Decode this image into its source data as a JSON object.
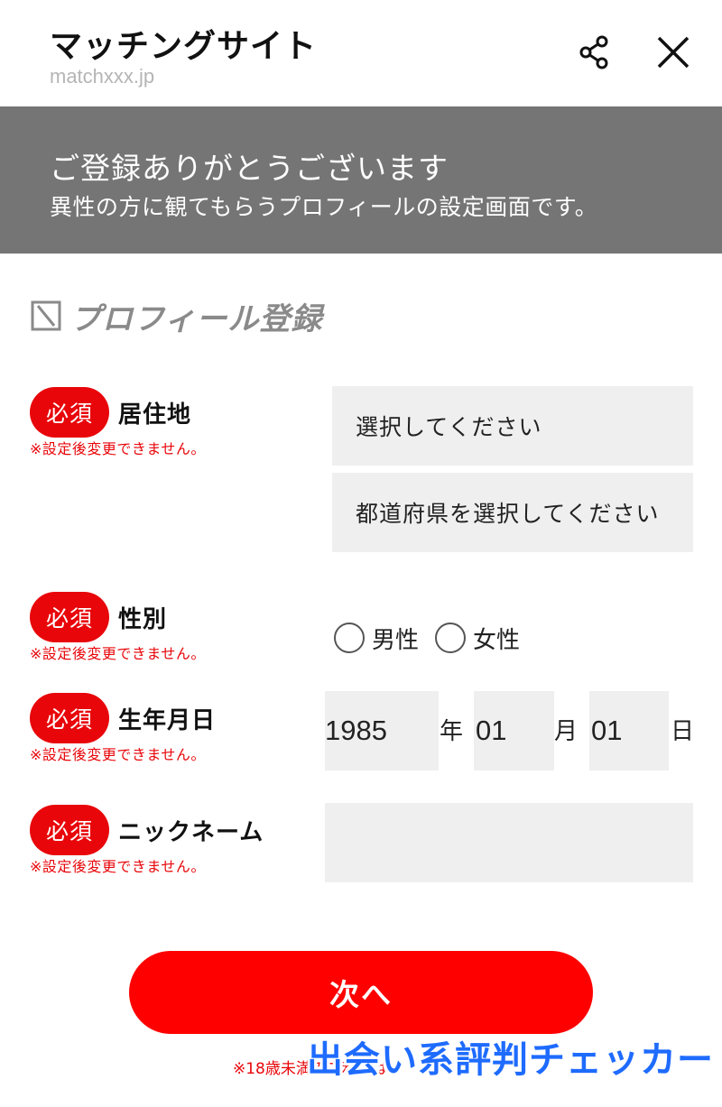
{
  "header": {
    "title": "マッチングサイト",
    "url": "matchxxx.jp"
  },
  "banner": {
    "title": "ご登録ありがとうございます",
    "subtitle": "異性の方に観てもらうプロフィールの設定画面です。"
  },
  "section": {
    "title": "プロフィール登録",
    "icon": "checkbox-cross-icon"
  },
  "required_badge": "必須",
  "note": "※設定後変更できません。",
  "fields": {
    "residence": {
      "label": "居住地",
      "select1": "選択してください",
      "select2": "都道府県を選択してください"
    },
    "gender": {
      "label": "性別",
      "options": [
        "男性",
        "女性"
      ]
    },
    "birthday": {
      "label": "生年月日",
      "year": "1985",
      "year_unit": "年",
      "month": "01",
      "month_unit": "月",
      "day": "01",
      "day_unit": "日"
    },
    "nickname": {
      "label": "ニックネーム",
      "value": ""
    }
  },
  "next_button": "次へ",
  "footnote": "※18歳未満のご利用は",
  "watermark": "出会い系評判チェッカー",
  "colors": {
    "accent": "#e8060a",
    "banner_bg": "#757575",
    "field_bg": "#efefef",
    "watermark": "#1e6bff"
  }
}
